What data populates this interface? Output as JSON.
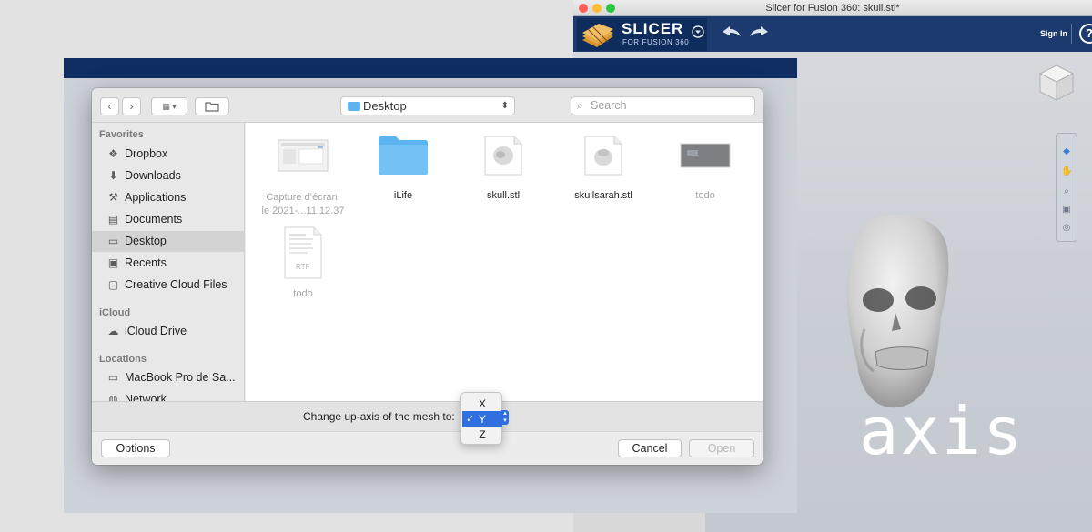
{
  "slicer": {
    "window_title": "Slicer for Fusion 360: skull.stl*",
    "logo_text": "SLICER",
    "logo_sub": "FOR FUSION 360",
    "sign_in_label": "Sign In",
    "help_label": "?",
    "colors": {
      "toolbar": "#1c3a6e",
      "viewport": "#c8ccd3"
    }
  },
  "dialog": {
    "location": "Desktop",
    "search_placeholder": "Search",
    "sidebar": {
      "favorites_heading": "Favorites",
      "favorites": [
        {
          "label": "Dropbox",
          "icon": "dropbox-icon"
        },
        {
          "label": "Downloads",
          "icon": "downloads-icon"
        },
        {
          "label": "Applications",
          "icon": "applications-icon"
        },
        {
          "label": "Documents",
          "icon": "documents-icon"
        },
        {
          "label": "Desktop",
          "icon": "desktop-icon",
          "selected": true
        },
        {
          "label": "Recents",
          "icon": "recents-icon"
        },
        {
          "label": "Creative Cloud Files",
          "icon": "folder-icon"
        }
      ],
      "icloud_heading": "iCloud",
      "icloud": [
        {
          "label": "iCloud Drive",
          "icon": "cloud-icon"
        }
      ],
      "locations_heading": "Locations",
      "locations": [
        {
          "label": "MacBook Pro de Sa...",
          "icon": "laptop-icon"
        },
        {
          "label": "Network",
          "icon": "network-icon"
        }
      ]
    },
    "files": [
      {
        "name_line1": "Capture d’écran,",
        "name_line2": "le 2021-...11.12.37",
        "kind": "screenshot",
        "dimmed": true
      },
      {
        "name_line1": "iLife",
        "name_line2": "",
        "kind": "folder",
        "dimmed": false
      },
      {
        "name_line1": "skull.stl",
        "name_line2": "",
        "kind": "stl",
        "dimmed": false
      },
      {
        "name_line1": "skullsarah.stl",
        "name_line2": "",
        "kind": "stl",
        "dimmed": false
      },
      {
        "name_line1": "todo",
        "name_line2": "",
        "kind": "image",
        "dimmed": true
      },
      {
        "name_line1": "todo",
        "name_line2": "",
        "kind": "rtf",
        "dimmed": true,
        "badge": "RTF"
      }
    ],
    "axis_label": "Change up-axis of the mesh to:",
    "axis_options": [
      "X",
      "Y",
      "Z"
    ],
    "axis_selected": "Y",
    "checkmark": "✓",
    "options_button": "Options",
    "cancel_button": "Cancel",
    "open_button": "Open"
  },
  "overlay_text": "axis"
}
